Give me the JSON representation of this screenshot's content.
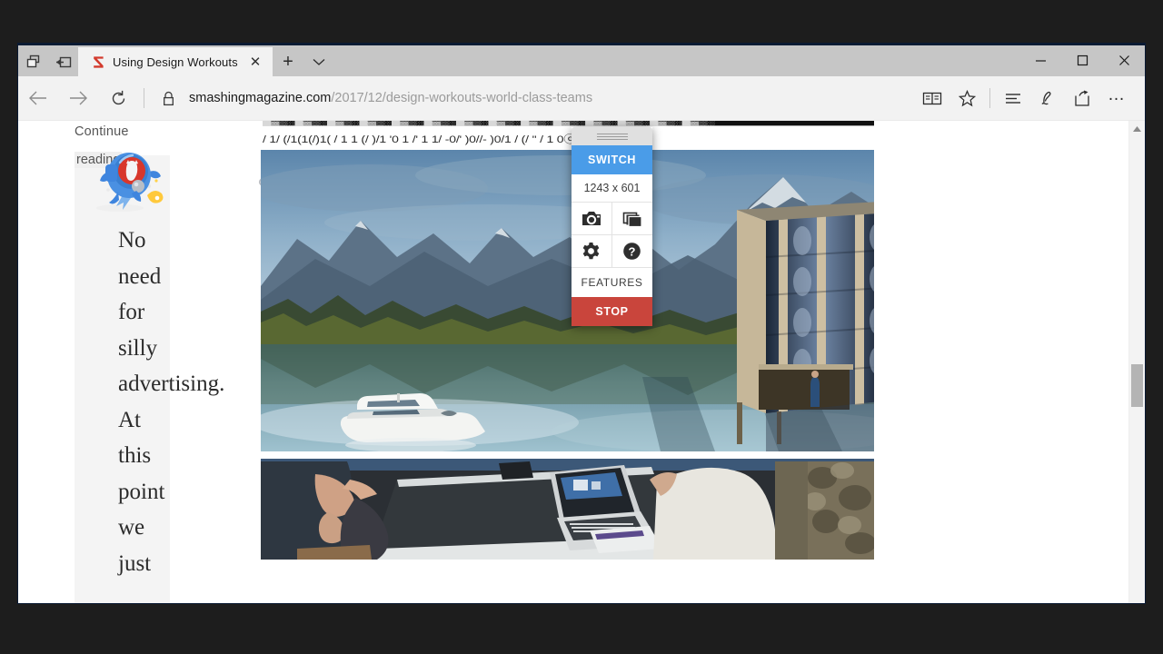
{
  "window": {
    "controls": {
      "minimize": "–",
      "maximize": "☐",
      "close": "✕"
    }
  },
  "tabstrip": {
    "set_tabs_aside_icon": "set-tabs-aside-icon",
    "restore_tabs_icon": "restore-tabs-icon",
    "tab": {
      "favicon": "smashing-magazine-favicon",
      "title": "Using Design Workouts",
      "close": "✕"
    },
    "new_tab": "+",
    "tab_menu": "⌄"
  },
  "navbar": {
    "back": "←",
    "forward": "→",
    "refresh": "↻",
    "lock_icon": "lock-icon",
    "url_host": "smashingmagazine.com",
    "url_path": "/2017/12/design-workouts-world-class-teams",
    "url_full": "smashingmagazine.com/2017/12/design-workouts-world-class-teams",
    "reading_view": "reading-view-icon",
    "favorite": "☆",
    "hub": "hub-icon",
    "web_note": "web-note-icon",
    "share": "share-icon",
    "settings_more": "…"
  },
  "page": {
    "continue_label": "Continue",
    "reading_label": "reading",
    "mascot": "smashing-cat-rocket-illustration",
    "link_anchor": "link-anchor-icon",
    "big_words": [
      "No",
      "need",
      "for",
      "silly",
      "advertising.",
      "At",
      "this",
      "point",
      "we",
      "just"
    ],
    "garbled_line_1": "█▓▒░█▓▒░█▓▒░█▓▒░█▓▒░█▓▒░█▓▒░█▓▒░█▓▒░█▓▒░█▓▒░█▓▒░█▓▒░█▓▒░",
    "garbled_line_2": "/ 1/ (/1(1(/)1( /   1    1 (/ )/1    '0  1 /'    1 1/ -0/' )0//- )0/1      /  (/ '' /  1  0ⓒ 1(0 / )1 (",
    "hero_image": "lake-mountains-building-boat-photo",
    "lower_image": "people-at-desk-with-laptop-photo"
  },
  "scrollbar": {
    "up_arrow": "▲"
  },
  "widget": {
    "drag_handle": "drag-handle",
    "switch_label": "SWITCH",
    "dimensions": "1243 x 601",
    "camera_icon": "camera-icon",
    "layers_icon": "layers-icon",
    "gear_icon": "gear-icon",
    "help_icon": "help-icon",
    "features_label": "FEATURES",
    "stop_label": "STOP",
    "colors": {
      "switch_bg": "#4a9ce8",
      "stop_bg": "#c9453c",
      "handle_bg": "#e0e0e0"
    }
  }
}
